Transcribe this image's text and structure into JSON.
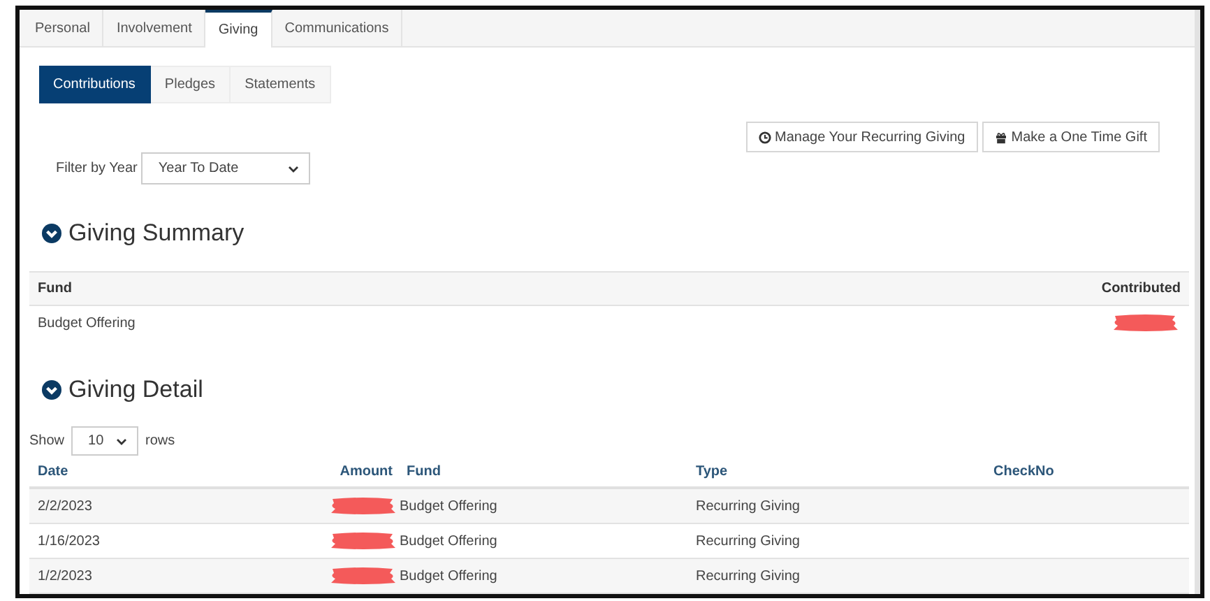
{
  "tabs": [
    {
      "label": "Personal",
      "selected": false
    },
    {
      "label": "Involvement",
      "selected": false
    },
    {
      "label": "Giving",
      "selected": true
    },
    {
      "label": "Communications",
      "selected": false
    }
  ],
  "subtabs": [
    {
      "label": "Contributions",
      "selected": true
    },
    {
      "label": "Pledges",
      "selected": false
    },
    {
      "label": "Statements",
      "selected": false
    }
  ],
  "actions": [
    {
      "label": "Manage Your Recurring Giving",
      "kind": "clock"
    },
    {
      "label": "Make a One Time Gift",
      "kind": "gift"
    }
  ],
  "filter": {
    "label": "Filter by Year",
    "value": "Year To Date"
  },
  "summary": {
    "title": "Giving Summary",
    "columns": [
      "Fund",
      "Contributed"
    ],
    "rows": [
      {
        "fund": "Budget Offering",
        "amount_redacted": true
      }
    ]
  },
  "detail": {
    "title": "Giving Detail",
    "show_label": "Show",
    "page_size": "10",
    "rows_label": "rows",
    "columns": [
      "Date",
      "Amount",
      "Fund",
      "Type",
      "CheckNo"
    ],
    "rows": [
      {
        "date": "2/2/2023",
        "amount_redacted": true,
        "fund": "Budget Offering",
        "type": "Recurring Giving"
      },
      {
        "date": "1/16/2023",
        "amount_redacted": true,
        "fund": "Budget Offering",
        "type": "Recurring Giving"
      },
      {
        "date": "1/2/2023",
        "amount_redacted": true,
        "fund": "Budget Offering",
        "type": "Recurring Giving"
      }
    ]
  }
}
